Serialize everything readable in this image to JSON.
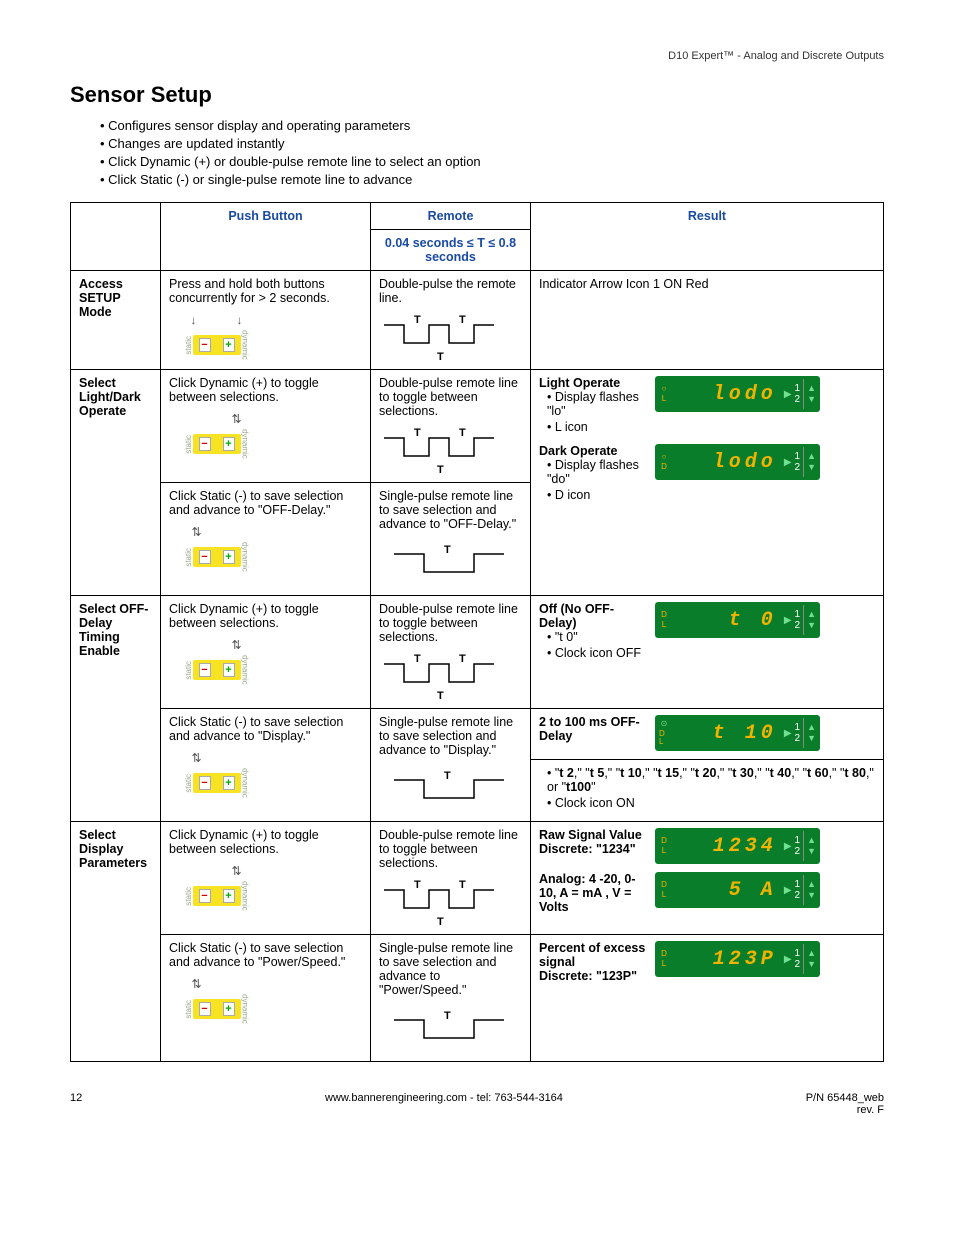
{
  "header": "D10 Expert™ - Analog and Discrete Outputs",
  "title": "Sensor Setup",
  "intro": [
    "Configures sensor display and operating parameters",
    "Changes are updated instantly",
    "Click Dynamic (+) or double-pulse remote line to select an option",
    "Click Static (-) or single-pulse remote line to advance"
  ],
  "cols": {
    "c1": "Push Button",
    "c2": "Remote",
    "c2sub": "0.04 seconds ≤ T ≤ 0.8 seconds",
    "c3": "Result"
  },
  "rows": {
    "access": {
      "label": "Access SETUP Mode",
      "push": "Press and hold both buttons concurrently for > 2 seconds.",
      "remote": "Double-pulse the remote line.",
      "result": "Indicator Arrow Icon 1 ON Red"
    },
    "lightdark": {
      "label": "Select Light/Dark Operate",
      "push1": "Click Dynamic (+) to toggle between selections.",
      "push2": "Click Static (-) to save selection and advance to \"OFF-Delay.\"",
      "remote1": "Double-pulse remote line to toggle between selections.",
      "remote2": "Single-pulse remote line to save selection and advance to \"OFF-Delay.\"",
      "r1_title": "Light Operate",
      "r1_items": [
        "Display flashes \"lo\"",
        "L icon"
      ],
      "r2_title": "Dark Operate",
      "r2_items": [
        "Display flashes \"do\"",
        "D icon"
      ],
      "lcd1": "lodo",
      "lcd2": "lodo"
    },
    "offdelay": {
      "label": "Select OFF-Delay Timing Enable",
      "push1": "Click Dynamic (+) to toggle between selections.",
      "push2": "Click Static (-) to save selection and advance to \"Display.\"",
      "remote1": "Double-pulse remote line to toggle between selections.",
      "remote2": "Single-pulse remote line to save selection and advance to \"Display.\"",
      "r1_title": "Off (No OFF-Delay)",
      "r1_items": [
        "\"t 0\"",
        "Clock icon OFF"
      ],
      "r2_title": "2 to 100 ms OFF-Delay",
      "lcd1": "t  0",
      "lcd2": "t 10",
      "delay_prefix": "",
      "delay_vals": [
        "t 2",
        "t 5",
        "t 10",
        "t 15",
        "t 20",
        "t 30",
        "t 40",
        "t 60",
        "t 80",
        "t100"
      ],
      "delay_suffix": "Clock icon ON"
    },
    "display": {
      "label": "Select Display Parameters",
      "push1": "Click Dynamic (+) to toggle between selections.",
      "push2": "Click Static (-) to save selection and advance to \"Power/Speed.\"",
      "remote1": "Double-pulse remote line to toggle between selections.",
      "remote2": "Single-pulse remote line to save selection and advance to \"Power/Speed.\"",
      "r1_title": "Raw Signal Value",
      "r1_sub": "Discrete: \"1234\"",
      "r2_title": "Analog: 4 -20, 0-10, A = mA , V = Volts",
      "r3_title": "Percent of excess signal",
      "r3_sub": "Discrete: \"123P\"",
      "lcd1": "1234",
      "lcd2": "5  A",
      "lcd3": "123P"
    }
  },
  "footer": {
    "page": "12",
    "center": "www.bannerengineering.com - tel: 763-544-3164",
    "pn": "P/N 65448_web",
    "rev": "rev. F"
  }
}
